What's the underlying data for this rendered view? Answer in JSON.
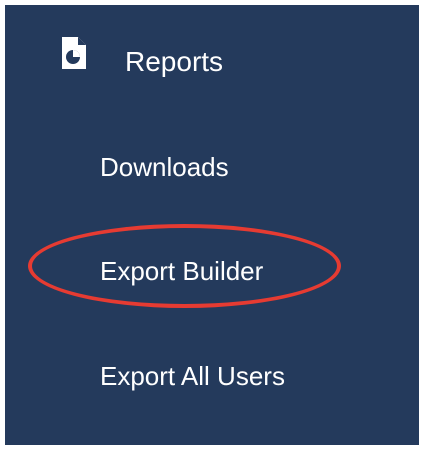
{
  "menu": {
    "title": "Reports",
    "icon": "report-file-icon",
    "items": [
      {
        "label": "Downloads"
      },
      {
        "label": "Export Builder",
        "highlighted": true
      },
      {
        "label": "Export All Users"
      }
    ]
  },
  "colors": {
    "sidebar_background": "#243a5c",
    "text": "#ffffff",
    "highlight": "#e63b32"
  }
}
